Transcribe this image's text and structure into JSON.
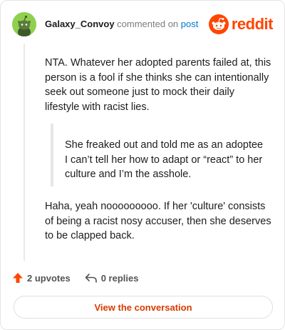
{
  "header": {
    "author": "Galaxy_Convoy",
    "commented_text": "commented on",
    "post_link": "post",
    "logo_text": "reddit",
    "avatar_icon": "snoo-avatar-icon",
    "logo_icon": "reddit-snoo-icon",
    "brand_color": "#ff4500",
    "avatar_color": "#8fd14f"
  },
  "comment": {
    "paragraph1": "NTA. Whatever her adopted parents failed at, this person is a fool if she thinks she can intentionally seek out someone just to mock their daily lifestyle with racist lies.",
    "quote": "She freaked out and told me as an adoptee I can’t tell her how to adapt or “react” to her culture and I’m the asshole.",
    "paragraph2": "Haha, yeah nooooooooo. If her 'culture' consists of being a racist nosy accuser, then she deserves to be clapped back."
  },
  "actions": {
    "upvotes": "2 upvotes",
    "replies": "0 replies",
    "upvote_icon": "upvote-arrow-icon",
    "reply_icon": "reply-arrow-icon"
  },
  "cta": {
    "label": "View the conversation"
  }
}
